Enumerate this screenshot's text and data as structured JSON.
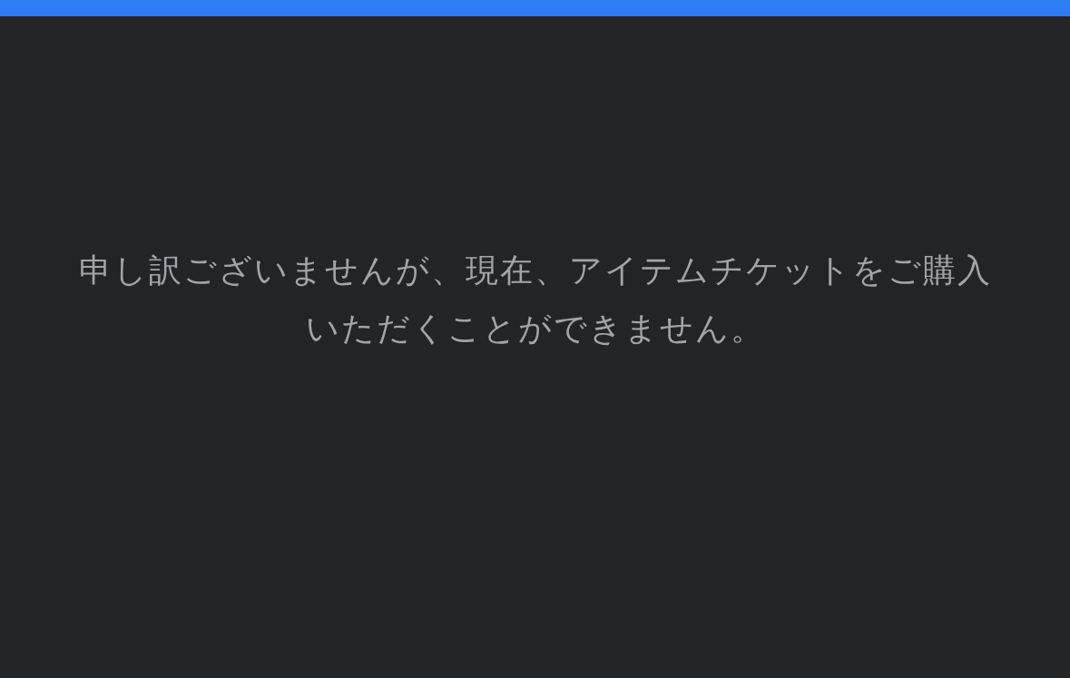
{
  "message": "申し訳ございませんが、現在、アイテムチケットをご購入いただくことができません。"
}
